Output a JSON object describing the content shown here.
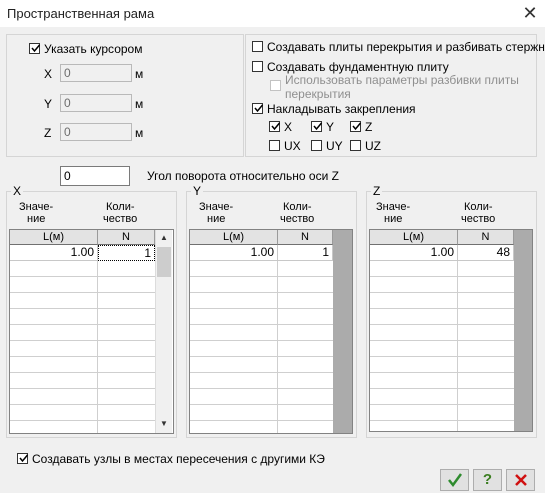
{
  "window": {
    "title": "Пространственная рама",
    "close_glyph": "✕"
  },
  "cursor_group": {
    "checkbox_label": "Указать курсором",
    "checked": true,
    "fields": [
      {
        "axis": "X",
        "value": "0",
        "unit": "м"
      },
      {
        "axis": "Y",
        "value": "0",
        "unit": "м"
      },
      {
        "axis": "Z",
        "value": "0",
        "unit": "м"
      }
    ]
  },
  "options_group": {
    "slabs_label": "Создавать плиты перекрытия и разбивать стержни",
    "foundation_label": "Создавать фундаментную плиту",
    "use_params_label_1": "Использовать параметры разбивки плиты",
    "use_params_label_2": "перекрытия",
    "restraints_label": "Накладывать закрепления",
    "restraints": [
      {
        "label": "X",
        "checked": true
      },
      {
        "label": "Y",
        "checked": true
      },
      {
        "label": "Z",
        "checked": true
      },
      {
        "label": "UX",
        "checked": false
      },
      {
        "label": "UY",
        "checked": false
      },
      {
        "label": "UZ",
        "checked": false
      }
    ]
  },
  "rotation": {
    "value": "0",
    "label": "Угол поворота относительно оси Z"
  },
  "tables": [
    {
      "axis": "X",
      "value_label_1": "Значе-",
      "value_label_2": "ние",
      "count_label_1": "Коли-",
      "count_label_2": "чество",
      "col_value": "L(м)",
      "col_count": "N",
      "row_value": "1.00",
      "row_count": "1"
    },
    {
      "axis": "Y",
      "value_label_1": "Значе-",
      "value_label_2": "ние",
      "count_label_1": "Коли-",
      "count_label_2": "чество",
      "col_value": "L(м)",
      "col_count": "N",
      "row_value": "1.00",
      "row_count": "1"
    },
    {
      "axis": "Z",
      "value_label_1": "Значе-",
      "value_label_2": "ние",
      "count_label_1": "Коли-",
      "count_label_2": "чество",
      "col_value": "L(м)",
      "col_count": "N",
      "row_value": "1.00",
      "row_count": "48"
    }
  ],
  "nodes_checkbox": {
    "label": "Создавать узлы в местах пересечения с другими КЭ",
    "checked": true
  },
  "buttons": {
    "ok_icon": "check-icon",
    "help_glyph": "?",
    "cancel_icon": "x-icon"
  },
  "colors": {
    "ok_green": "#2e8b2e",
    "help_green": "#3a7d1f",
    "cancel_red": "#d01010"
  }
}
